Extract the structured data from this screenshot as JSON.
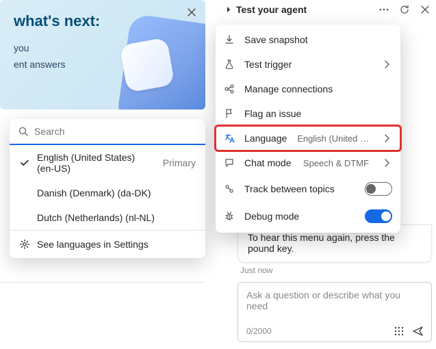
{
  "banner": {
    "title": "what's next:",
    "line1": "you",
    "line2": "ent answers"
  },
  "languageSearch": {
    "placeholder": "Search",
    "options": [
      {
        "label": "English (United States) (en-US)",
        "primary": "Primary",
        "checked": true
      },
      {
        "label": "Danish (Denmark) (da-DK)",
        "primary": "",
        "checked": false
      },
      {
        "label": "Dutch (Netherlands) (nl-NL)",
        "primary": "",
        "checked": false
      }
    ],
    "settingsLink": "See languages in Settings"
  },
  "chat": {
    "headerTitle": "Test your agent",
    "bubbleText": "To hear this menu again, press the pound key.",
    "timestamp": "Just now",
    "composerPlaceholder": "Ask a question or describe what you need",
    "charCounter": "0/2000"
  },
  "testMenu": {
    "items": [
      {
        "id": "snapshot",
        "label": "Save snapshot",
        "value": "",
        "chevron": false
      },
      {
        "id": "trigger",
        "label": "Test trigger",
        "value": "",
        "chevron": true
      },
      {
        "id": "conn",
        "label": "Manage connections",
        "value": "",
        "chevron": false
      },
      {
        "id": "flag",
        "label": "Flag an issue",
        "value": "",
        "chevron": false
      },
      {
        "id": "lang",
        "label": "Language",
        "value": "English (United …",
        "chevron": true,
        "highlight": true
      },
      {
        "id": "chatmode",
        "label": "Chat mode",
        "value": "Speech & DTMF",
        "chevron": true
      },
      {
        "id": "track",
        "label": "Track between topics",
        "value": "",
        "toggle": "off"
      },
      {
        "id": "debug",
        "label": "Debug mode",
        "value": "",
        "toggle": "on"
      }
    ]
  }
}
